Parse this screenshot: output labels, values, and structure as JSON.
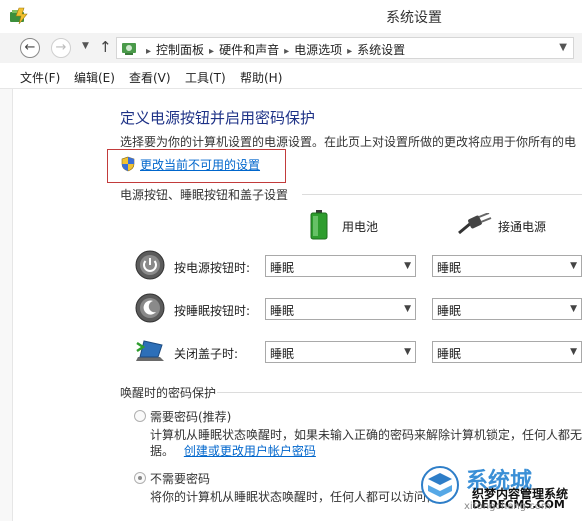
{
  "window": {
    "title": "系统设置"
  },
  "breadcrumb": [
    "控制面板",
    "硬件和声音",
    "电源选项",
    "系统设置"
  ],
  "menu": [
    "文件(F)",
    "编辑(E)",
    "查看(V)",
    "工具(T)",
    "帮助(H)"
  ],
  "main": {
    "heading": "定义电源按钮并启用密码保护",
    "description": "选择要为你的计算机设置的电源设置。在此页上对设置所做的更改将应用于你所有的电",
    "change_link": "更改当前不可用的设置"
  },
  "buttons_section": {
    "title": "电源按钮、睡眠按钮和盖子设置",
    "col_battery": "用电池",
    "col_plugged": "接通电源",
    "rows": [
      {
        "label": "按电源按钮时:",
        "battery": "睡眠",
        "plugged": "睡眠"
      },
      {
        "label": "按睡眠按钮时:",
        "battery": "睡眠",
        "plugged": "睡眠"
      },
      {
        "label": "关闭盖子时:",
        "battery": "睡眠",
        "plugged": "睡眠"
      }
    ]
  },
  "password_section": {
    "title": "唤醒时的密码保护",
    "opt_require": "需要密码(推荐)",
    "opt_require_desc1": "计算机从睡眠状态唤醒时，如果未输入正确的密码来解除计算机锁定，任何人都无",
    "opt_require_desc2_prefix": "据。",
    "opt_require_link": "创建或更改用户帐户密码",
    "opt_none": "不需要密码",
    "opt_none_desc": "将你的计算机从睡眠状态唤醒时，任何人都可以访问你的"
  },
  "watermark": {
    "brand": "系统城",
    "site": "xitongcheng.com",
    "overlay1": "织梦内容管理系统",
    "overlay2": "DEDECMS.COM"
  }
}
